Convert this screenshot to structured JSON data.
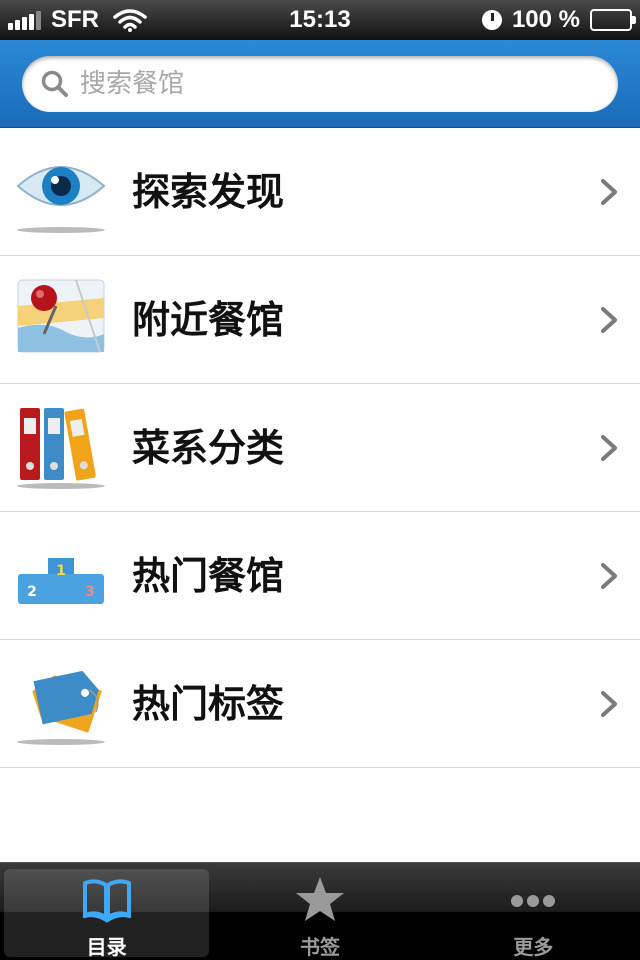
{
  "status_bar": {
    "carrier": "SFR",
    "time": "15:13",
    "battery": "100 %"
  },
  "search": {
    "placeholder": "搜索餐馆"
  },
  "menu": {
    "items": [
      {
        "label": "探索发现",
        "icon": "eye-icon"
      },
      {
        "label": "附近餐馆",
        "icon": "map-pin-icon"
      },
      {
        "label": "菜系分类",
        "icon": "binders-icon"
      },
      {
        "label": "热门餐馆",
        "icon": "podium-icon"
      },
      {
        "label": "热门标签",
        "icon": "tags-icon"
      }
    ]
  },
  "tab_bar": {
    "tabs": [
      {
        "label": "目录",
        "icon": "book-icon",
        "active": true
      },
      {
        "label": "书签",
        "icon": "star-icon",
        "active": false
      },
      {
        "label": "更多",
        "icon": "more-dots-icon",
        "active": false
      }
    ]
  },
  "colors": {
    "header_blue": "#2a89d6",
    "active_tab_icon": "#3fa9f5"
  }
}
